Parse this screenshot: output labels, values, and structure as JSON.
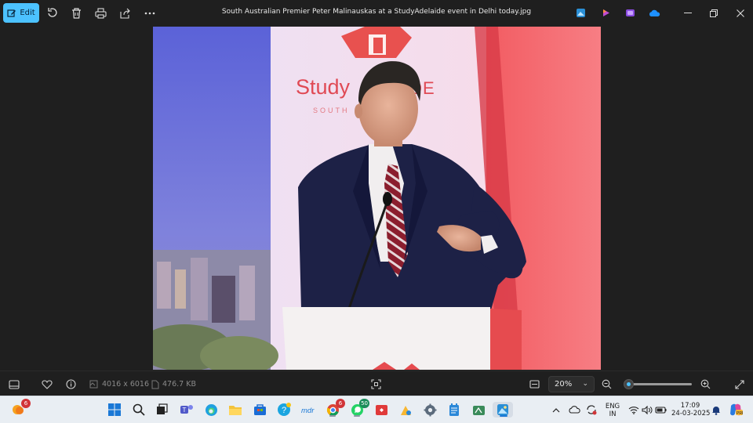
{
  "toolbar": {
    "edit_label": "Edit",
    "rotate_icon": "rotate-icon",
    "delete_icon": "trash-icon",
    "print_icon": "print-icon",
    "share_icon": "share-icon",
    "more_icon": "more-icon"
  },
  "window": {
    "title": "South Australian Premier Peter Malinauskas at a StudyAdelaide event in Delhi today.jpg"
  },
  "photo": {
    "banner_text": "StudyADELAIDE",
    "banner_sub": "SOUTH AUSTRALIA"
  },
  "statusbar": {
    "dimensions": "4016 x 6016",
    "file_size": "476.7 KB",
    "zoom_value": "20%",
    "zoom_fraction": 0.06
  },
  "taskbar": {
    "badge_weather": "6",
    "badge_chrome": "6",
    "badge_whatsapp": "50",
    "lang_top": "ENG",
    "lang_bottom": "IN",
    "time": "17:09",
    "date": "24-03-2025"
  },
  "colors": {
    "accent": "#4cc2ff",
    "app_bg": "#1f1f1f",
    "taskbar_bg": "#e9eef3",
    "badge_red": "#d13438"
  }
}
